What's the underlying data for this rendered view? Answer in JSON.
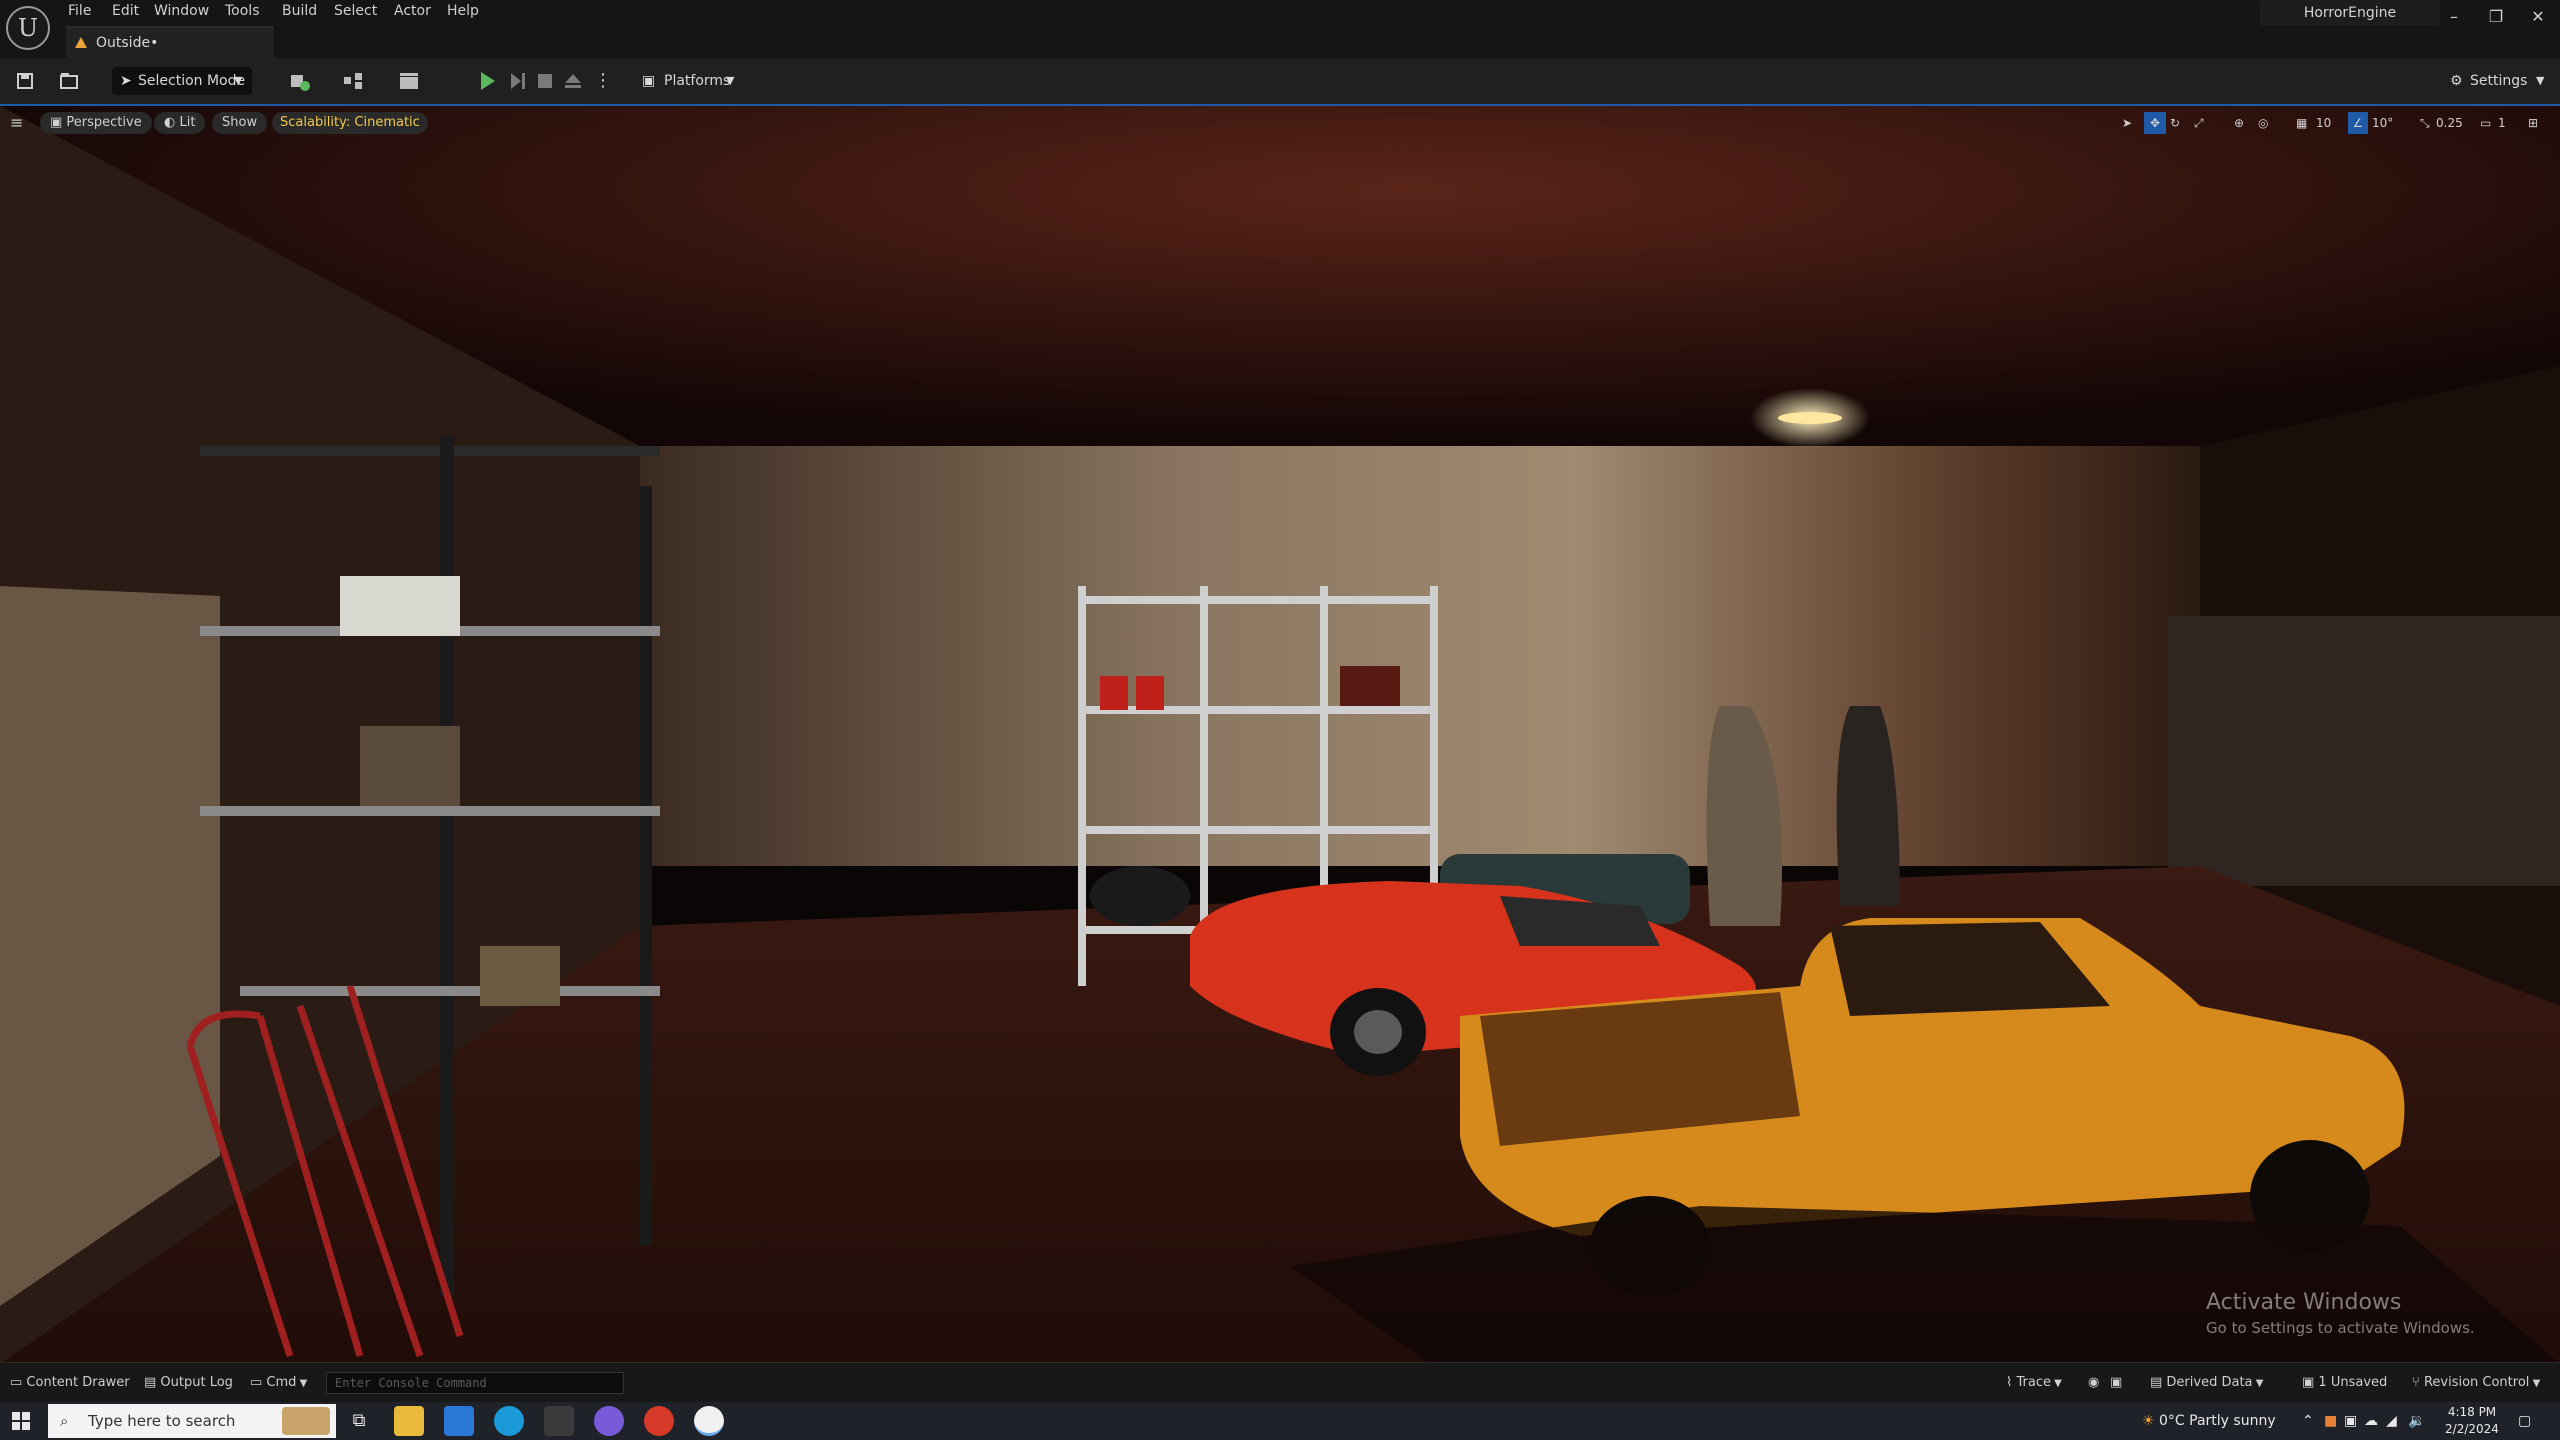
{
  "menu": {
    "items": [
      "File",
      "Edit",
      "Window",
      "Tools",
      "Build",
      "Select",
      "Actor",
      "Help"
    ]
  },
  "tab": {
    "label": "Outside•"
  },
  "project": {
    "name": "HorrorEngine"
  },
  "toolbar": {
    "selection_mode": "Selection Mode",
    "platforms": "Platforms",
    "settings": "Settings"
  },
  "viewport": {
    "perspective": "Perspective",
    "lit": "Lit",
    "show": "Show",
    "scalability": "Scalability: Cinematic",
    "grid_value": "10",
    "angle_value": "10°",
    "scale_value": "0.25",
    "camera_value": "1"
  },
  "watermark": {
    "line1": "Activate Windows",
    "line2": "Go to Settings to activate Windows."
  },
  "statusbar": {
    "content_drawer": "Content Drawer",
    "output_log": "Output Log",
    "cmd": "Cmd",
    "console_placeholder": "Enter Console Command",
    "trace": "Trace",
    "derived_data": "Derived Data",
    "unsaved": "1 Unsaved",
    "revision_control": "Revision Control"
  },
  "taskbar": {
    "search_placeholder": "Type here to search",
    "weather": "0°C  Partly sunny",
    "time": "4:18 PM",
    "date": "2/2/2024"
  },
  "colors": {
    "accent_blue": "#1e5aa8",
    "play_green": "#5cb85c",
    "scalability_yellow": "#f2c94c"
  }
}
